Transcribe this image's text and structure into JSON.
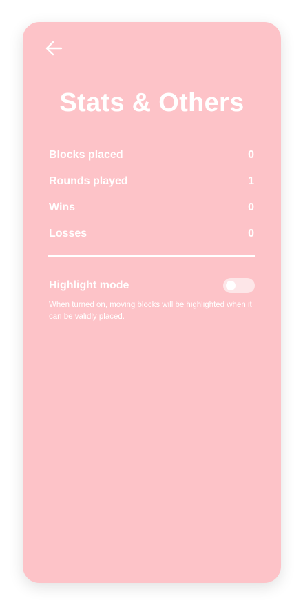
{
  "screen": {
    "title": "Stats & Others",
    "back_icon": "arrow-left-icon"
  },
  "stats": [
    {
      "label": "Blocks placed",
      "value": "0"
    },
    {
      "label": "Rounds played",
      "value": "1"
    },
    {
      "label": "Wins",
      "value": "0"
    },
    {
      "label": "Losses",
      "value": "0"
    }
  ],
  "settings": {
    "highlight": {
      "label": "Highlight mode",
      "enabled": false,
      "description": "When turned on, moving blocks will be highlighted when it can be validly placed."
    }
  },
  "colors": {
    "background": "#fdc3c8",
    "text": "#ffffff",
    "toggle_track": "#fde6e8"
  }
}
